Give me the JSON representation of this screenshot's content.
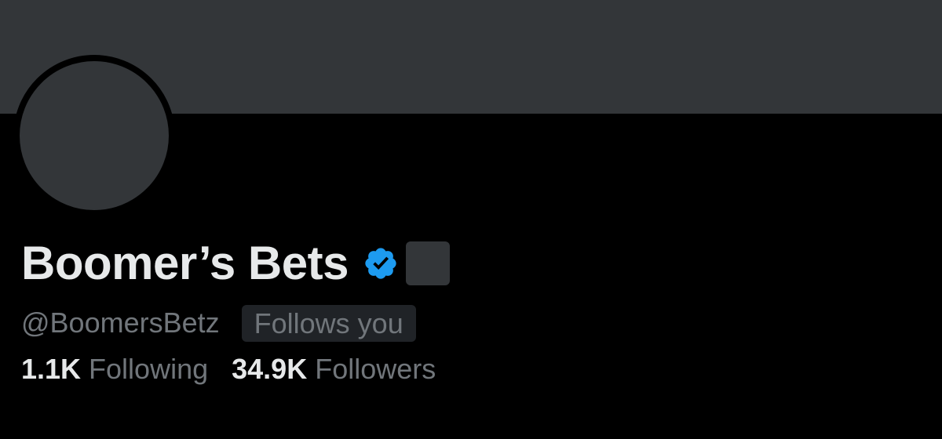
{
  "profile": {
    "display_name": "Boomer’s Bets",
    "handle": "@BoomersBetz",
    "follows_you_label": "Follows you",
    "verified_icon": "verified-badge-icon",
    "stats": {
      "following_count": "1.1K",
      "following_label": "Following",
      "followers_count": "34.9K",
      "followers_label": "Followers"
    }
  },
  "colors": {
    "background": "#000000",
    "banner": "#333639",
    "primary_text": "#e7e9ea",
    "secondary_text": "#71767b",
    "verified_blue": "#1d9bf0"
  }
}
